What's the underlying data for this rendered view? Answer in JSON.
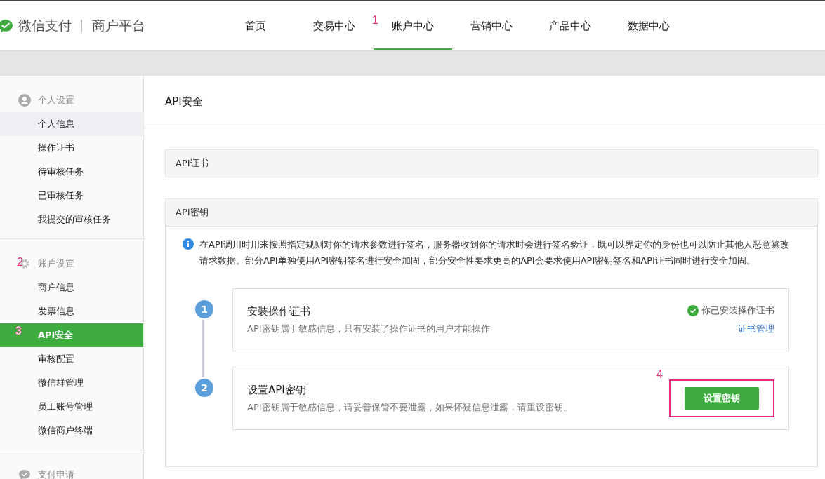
{
  "header": {
    "brand": "微信支付",
    "product": "商户平台",
    "nav": [
      {
        "label": "首页",
        "selected": false
      },
      {
        "label": "交易中心",
        "selected": false
      },
      {
        "label": "账户中心",
        "selected": true,
        "annotation": "1"
      },
      {
        "label": "营销中心",
        "selected": false
      },
      {
        "label": "产品中心",
        "selected": false
      },
      {
        "label": "数据中心",
        "selected": false
      }
    ]
  },
  "sidebar": {
    "groups": [
      {
        "kind": "person",
        "title": "个人设置",
        "items": [
          {
            "label": "个人信息",
            "selected": false,
            "hovered": true
          },
          {
            "label": "操作证书",
            "selected": false,
            "hovered": false
          },
          {
            "label": "待审核任务",
            "selected": false,
            "hovered": false
          },
          {
            "label": "已审核任务",
            "selected": false,
            "hovered": false
          },
          {
            "label": "我提交的审核任务",
            "selected": false,
            "hovered": false
          }
        ]
      },
      {
        "kind": "gear",
        "title": "账户设置",
        "annotation": "2",
        "items": [
          {
            "label": "商户信息",
            "selected": false,
            "hovered": false
          },
          {
            "label": "发票信息",
            "selected": false,
            "hovered": false
          },
          {
            "label": "API安全",
            "selected": true,
            "hovered": false,
            "annotation": "3"
          },
          {
            "label": "审核配置",
            "selected": false,
            "hovered": false
          },
          {
            "label": "微信群管理",
            "selected": false,
            "hovered": false
          },
          {
            "label": "员工账号管理",
            "selected": false,
            "hovered": false
          },
          {
            "label": "微信商户终端",
            "selected": false,
            "hovered": false
          }
        ]
      },
      {
        "kind": "chat",
        "title": "支付申请"
      }
    ]
  },
  "main": {
    "title": "API安全",
    "panels": [
      {
        "title": "API证书",
        "expanded": false
      },
      {
        "title": "API密钥",
        "expanded": true,
        "info": "在API调用时用来按照指定规则对你的请求参数进行签名，服务器收到你的请求时会进行签名验证，既可以界定你的身份也可以防止其他人恶意篡改请求数据。部分API单独使用API密钥签名进行安全加固，部分安全性要求更高的API会要求使用API密钥签名和API证书同时进行安全加固。",
        "steps": [
          {
            "number": "1",
            "kind": "status",
            "title": "安装操作证书",
            "description": "API密钥属于敏感信息，只有安装了操作证书的用户才能操作",
            "status": "你已安装操作证书",
            "link": "证书管理"
          },
          {
            "number": "2",
            "kind": "action",
            "title": "设置API密钥",
            "description": "API密钥属于敏感信息，请妥善保管不要泄露，如果怀疑信息泄露，请重设密钥。",
            "button": "设置密钥",
            "annotation": "4"
          }
        ]
      }
    ]
  }
}
